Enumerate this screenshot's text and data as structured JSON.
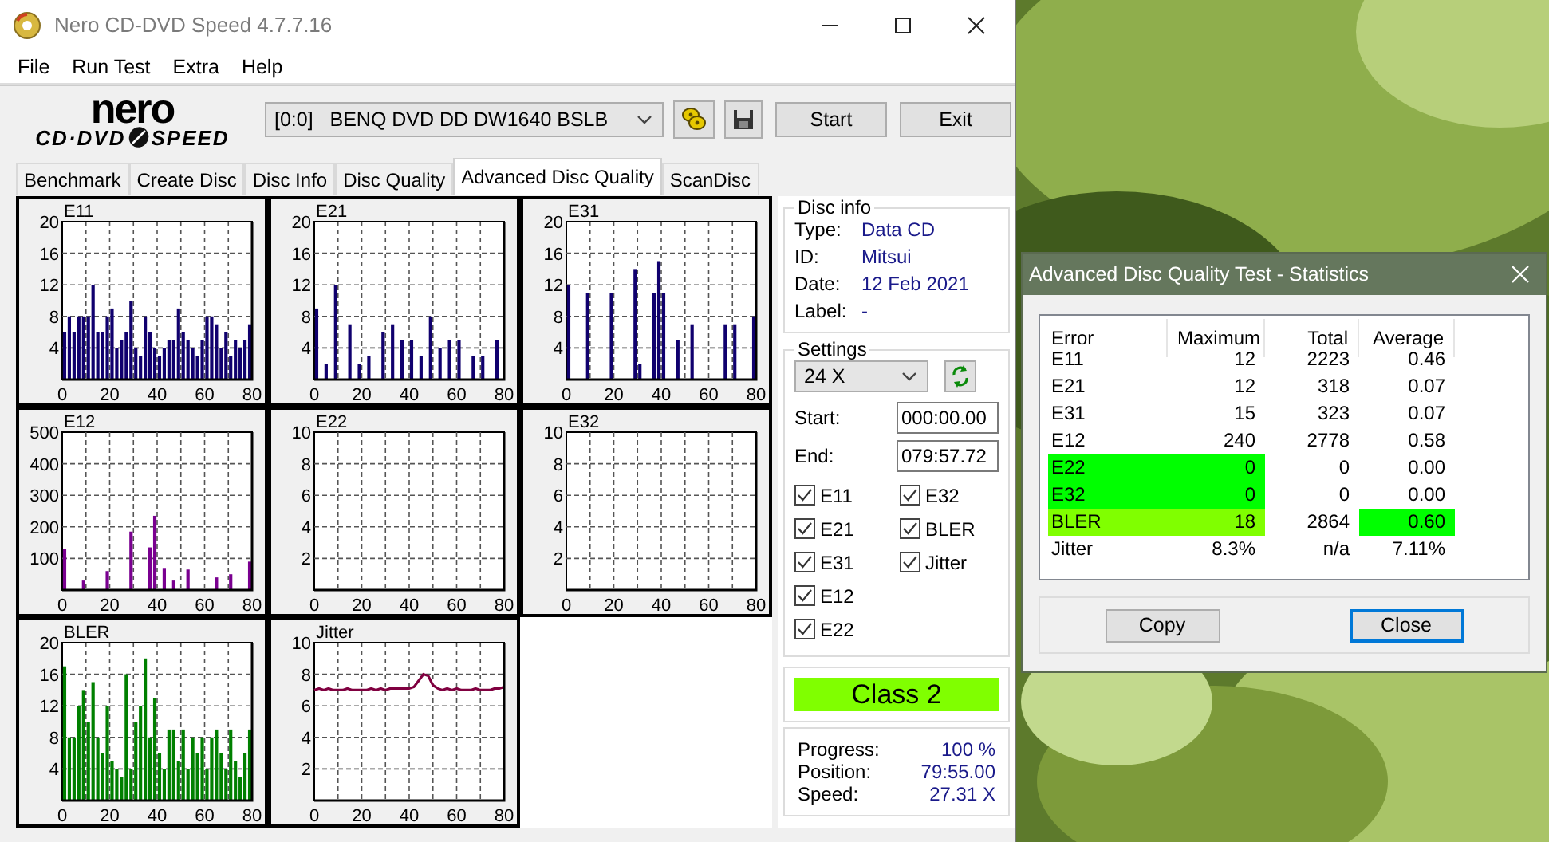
{
  "window": {
    "title": "Nero CD-DVD Speed 4.7.7.16"
  },
  "menu": [
    "File",
    "Run Test",
    "Extra",
    "Help"
  ],
  "logo": {
    "top": "nero",
    "left": "CD·DVD",
    "right": "SPEED"
  },
  "drive": "[0:0]   BENQ DVD DD DW1640 BSLB",
  "buttons": [
    "Start",
    "Exit"
  ],
  "tabs": [
    {
      "label": "Benchmark",
      "selected": false
    },
    {
      "label": "Create Disc",
      "selected": false
    },
    {
      "label": "Disc Info",
      "selected": false
    },
    {
      "label": "Disc Quality",
      "selected": false
    },
    {
      "label": "Advanced Disc Quality",
      "selected": true
    },
    {
      "label": "ScanDisc",
      "selected": false
    }
  ],
  "charts": [
    {
      "chart_data": {
        "type": "bar",
        "title": "E11",
        "grid": true,
        "xlim": [
          0,
          80
        ],
        "ylim": [
          0,
          20
        ],
        "xticks": [
          0,
          20,
          40,
          60,
          80
        ],
        "yticks": [
          4,
          8,
          12,
          16,
          20
        ],
        "x": [
          1,
          3,
          5,
          7,
          9,
          11,
          13,
          15,
          17,
          19,
          21,
          23,
          25,
          27,
          29,
          31,
          33,
          35,
          37,
          39,
          41,
          43,
          45,
          47,
          49,
          51,
          53,
          55,
          57,
          59,
          61,
          63,
          65,
          67,
          69,
          71,
          73,
          75,
          77,
          79
        ],
        "series": [
          {
            "color": "#10006e",
            "values": [
              6,
              8,
              6,
              8,
              8,
              8,
              12,
              6,
              6,
              8,
              9,
              4,
              5,
              6,
              10,
              4,
              3,
              8,
              6,
              4,
              3,
              4,
              5,
              5,
              9,
              6,
              5,
              4,
              3,
              5,
              8,
              8,
              7,
              4,
              6,
              3,
              5,
              4,
              5,
              7
            ]
          }
        ]
      }
    },
    {
      "chart_data": {
        "type": "bar",
        "title": "E21",
        "grid": true,
        "xlim": [
          0,
          80
        ],
        "ylim": [
          0,
          20
        ],
        "xticks": [
          0,
          20,
          40,
          60,
          80
        ],
        "yticks": [
          4,
          8,
          12,
          16,
          20
        ],
        "x": [
          1,
          3,
          5,
          7,
          9,
          11,
          13,
          15,
          17,
          19,
          21,
          23,
          25,
          27,
          29,
          31,
          33,
          35,
          37,
          39,
          41,
          43,
          45,
          47,
          49,
          51,
          53,
          55,
          57,
          59,
          61,
          63,
          65,
          67,
          69,
          71,
          73,
          75,
          77,
          79
        ],
        "series": [
          {
            "color": "#10006e",
            "values": [
              9,
              0,
              2,
              0,
              12,
              0,
              0,
              7,
              0,
              2,
              0,
              3,
              0,
              0,
              6,
              0,
              7,
              0,
              5,
              0,
              5,
              0,
              3,
              0,
              8,
              0,
              4,
              0,
              5,
              0,
              5,
              0,
              0,
              3,
              0,
              3,
              0,
              0,
              5,
              0
            ]
          }
        ]
      }
    },
    {
      "chart_data": {
        "type": "bar",
        "title": "E31",
        "grid": true,
        "xlim": [
          0,
          80
        ],
        "ylim": [
          0,
          20
        ],
        "xticks": [
          0,
          20,
          40,
          60,
          80
        ],
        "yticks": [
          4,
          8,
          12,
          16,
          20
        ],
        "x": [
          1,
          3,
          5,
          7,
          9,
          11,
          13,
          15,
          17,
          19,
          21,
          23,
          25,
          27,
          29,
          31,
          33,
          35,
          37,
          39,
          41,
          43,
          45,
          47,
          49,
          51,
          53,
          55,
          57,
          59,
          61,
          63,
          65,
          67,
          69,
          71,
          73,
          75,
          77,
          79
        ],
        "series": [
          {
            "color": "#10006e",
            "values": [
              12,
              0,
              0,
              0,
              11,
              0,
              0,
              0,
              0,
              11,
              0,
              0,
              0,
              0,
              14,
              2,
              0,
              0,
              11,
              15,
              11,
              0,
              0,
              5,
              0,
              0,
              7,
              0,
              0,
              0,
              0,
              0,
              0,
              7,
              0,
              7,
              0,
              0,
              0,
              8
            ]
          }
        ]
      }
    },
    {
      "chart_data": {
        "type": "bar",
        "title": "E12",
        "grid": true,
        "xlim": [
          0,
          80
        ],
        "ylim": [
          0,
          500
        ],
        "xticks": [
          0,
          20,
          40,
          60,
          80
        ],
        "yticks": [
          100,
          200,
          300,
          400,
          500
        ],
        "x": [
          1,
          3,
          5,
          7,
          9,
          11,
          13,
          15,
          17,
          19,
          21,
          23,
          25,
          27,
          29,
          31,
          33,
          35,
          37,
          39,
          41,
          43,
          45,
          47,
          49,
          51,
          53,
          55,
          57,
          59,
          61,
          63,
          65,
          67,
          69,
          71,
          73,
          75,
          77,
          79
        ],
        "series": [
          {
            "color": "#7a0090",
            "values": [
              130,
              0,
              0,
              0,
              30,
              0,
              0,
              0,
              0,
              60,
              0,
              0,
              0,
              0,
              185,
              0,
              0,
              0,
              135,
              235,
              0,
              70,
              0,
              30,
              0,
              0,
              65,
              0,
              0,
              0,
              0,
              0,
              40,
              0,
              0,
              50,
              0,
              0,
              0,
              90
            ]
          }
        ]
      }
    },
    {
      "chart_data": {
        "type": "bar",
        "title": "E22",
        "grid": true,
        "xlim": [
          0,
          80
        ],
        "ylim": [
          0,
          10
        ],
        "xticks": [
          0,
          20,
          40,
          60,
          80
        ],
        "yticks": [
          2,
          4,
          6,
          8,
          10
        ],
        "x": [
          1,
          3,
          5,
          7,
          9,
          11,
          13,
          15,
          17,
          19,
          21,
          23,
          25,
          27,
          29,
          31,
          33,
          35,
          37,
          39,
          41,
          43,
          45,
          47,
          49,
          51,
          53,
          55,
          57,
          59,
          61,
          63,
          65,
          67,
          69,
          71,
          73,
          75,
          77,
          79
        ],
        "series": [
          {
            "values": [
              0,
              0,
              0,
              0,
              0,
              0,
              0,
              0,
              0,
              0,
              0,
              0,
              0,
              0,
              0,
              0,
              0,
              0,
              0,
              0,
              0,
              0,
              0,
              0,
              0,
              0,
              0,
              0,
              0,
              0,
              0,
              0,
              0,
              0,
              0,
              0,
              0,
              0,
              0,
              0
            ]
          }
        ]
      }
    },
    {
      "chart_data": {
        "type": "bar",
        "title": "E32",
        "grid": true,
        "xlim": [
          0,
          80
        ],
        "ylim": [
          0,
          10
        ],
        "xticks": [
          0,
          20,
          40,
          60,
          80
        ],
        "yticks": [
          2,
          4,
          6,
          8,
          10
        ],
        "x": [
          1,
          3,
          5,
          7,
          9,
          11,
          13,
          15,
          17,
          19,
          21,
          23,
          25,
          27,
          29,
          31,
          33,
          35,
          37,
          39,
          41,
          43,
          45,
          47,
          49,
          51,
          53,
          55,
          57,
          59,
          61,
          63,
          65,
          67,
          69,
          71,
          73,
          75,
          77,
          79
        ],
        "series": [
          {
            "values": [
              0,
              0,
              0,
              0,
              0,
              0,
              0,
              0,
              0,
              0,
              0,
              0,
              0,
              0,
              0,
              0,
              0,
              0,
              0,
              0,
              0,
              0,
              0,
              0,
              0,
              0,
              0,
              0,
              0,
              0,
              0,
              0,
              0,
              0,
              0,
              0,
              0,
              0,
              0,
              0
            ]
          }
        ]
      }
    },
    {
      "chart_data": {
        "type": "bar",
        "title": "BLER",
        "grid": true,
        "xlim": [
          0,
          80
        ],
        "ylim": [
          0,
          20
        ],
        "xticks": [
          0,
          20,
          40,
          60,
          80
        ],
        "yticks": [
          4,
          8,
          12,
          16,
          20
        ],
        "x": [
          1,
          3,
          5,
          7,
          9,
          11,
          13,
          15,
          17,
          19,
          21,
          23,
          25,
          27,
          29,
          31,
          33,
          35,
          37,
          39,
          41,
          43,
          45,
          47,
          49,
          51,
          53,
          55,
          57,
          59,
          61,
          63,
          65,
          67,
          69,
          71,
          73,
          75,
          77,
          79
        ],
        "series": [
          {
            "color": "#008000",
            "values": [
              17,
              8,
              8,
              12,
              14,
              10,
              15,
              8,
              6,
              12,
              5,
              4,
              3,
              16,
              4,
              10,
              12,
              18,
              8,
              13,
              6,
              4,
              9,
              9,
              5,
              9,
              4,
              8,
              6,
              8,
              4,
              8,
              9,
              6,
              4,
              9,
              5,
              3,
              6,
              9
            ]
          }
        ]
      }
    },
    {
      "chart_data": {
        "type": "line",
        "title": "Jitter",
        "grid": true,
        "xlim": [
          0,
          80
        ],
        "ylim": [
          0,
          10
        ],
        "xticks": [
          0,
          20,
          40,
          60,
          80
        ],
        "yticks": [
          2,
          4,
          6,
          8,
          10
        ],
        "x": [
          0,
          2,
          4,
          6,
          8,
          10,
          12,
          14,
          16,
          18,
          20,
          22,
          24,
          26,
          28,
          30,
          32,
          34,
          36,
          38,
          40,
          42,
          44,
          46,
          48,
          50,
          52,
          54,
          56,
          58,
          60,
          62,
          64,
          66,
          68,
          70,
          72,
          74,
          76,
          78,
          80
        ],
        "series": [
          {
            "color": "#800040",
            "values": [
              7.0,
              7.1,
              7.0,
              7.1,
              7.0,
              7.0,
              7.0,
              7.1,
              7.0,
              7.0,
              7.0,
              7.0,
              7.1,
              7.0,
              7.1,
              7.0,
              7.1,
              7.1,
              7.1,
              7.1,
              7.1,
              7.2,
              7.6,
              8.0,
              7.9,
              7.3,
              7.1,
              7.0,
              7.1,
              7.0,
              7.1,
              7.0,
              7.0,
              7.0,
              7.1,
              7.0,
              7.0,
              7.0,
              7.1,
              7.1,
              7.2
            ]
          }
        ]
      }
    }
  ],
  "disc_info": {
    "title": "Disc info",
    "fields": [
      {
        "label": "Type:",
        "value": "Data CD"
      },
      {
        "label": "ID:",
        "value": "Mitsui"
      },
      {
        "label": "Date:",
        "value": "12 Feb 2021"
      },
      {
        "label": "Label:",
        "value": "-"
      }
    ]
  },
  "settings": {
    "title": "Settings",
    "speed": "24 X",
    "start": {
      "label": "Start:",
      "value": "000:00.00"
    },
    "end": {
      "label": "End:",
      "value": "079:57.72"
    },
    "checks": [
      {
        "label": "E11",
        "checked": true
      },
      {
        "label": "E21",
        "checked": true
      },
      {
        "label": "E31",
        "checked": true
      },
      {
        "label": "E12",
        "checked": true
      },
      {
        "label": "E22",
        "checked": true
      },
      {
        "label": "E32",
        "checked": true
      },
      {
        "label": "BLER",
        "checked": true
      },
      {
        "label": "Jitter",
        "checked": true
      }
    ]
  },
  "class_badge": {
    "text": "Class 2",
    "color": "#80ff00"
  },
  "progress": [
    {
      "label": "Progress:",
      "value": "100 %"
    },
    {
      "label": "Position:",
      "value": "79:55.00"
    },
    {
      "label": "Speed:",
      "value": "27.31 X"
    }
  ],
  "stats": {
    "title": "Advanced Disc Quality Test - Statistics",
    "columns": [
      "Error",
      "Maximum",
      "Total",
      "Average"
    ],
    "rows": [
      {
        "cells": [
          {
            "text": "E11"
          },
          {
            "text": "12"
          },
          {
            "text": "2223"
          },
          {
            "text": "0.46"
          }
        ]
      },
      {
        "cells": [
          {
            "text": "E21"
          },
          {
            "text": "12"
          },
          {
            "text": "318"
          },
          {
            "text": "0.07"
          }
        ]
      },
      {
        "cells": [
          {
            "text": "E31"
          },
          {
            "text": "15"
          },
          {
            "text": "323"
          },
          {
            "text": "0.07"
          }
        ]
      },
      {
        "cells": [
          {
            "text": "E12"
          },
          {
            "text": "240"
          },
          {
            "text": "2778"
          },
          {
            "text": "0.58"
          }
        ]
      },
      {
        "cells": [
          {
            "text": "E22",
            "color": "#00ff00"
          },
          {
            "text": "0",
            "color": "#00ff00"
          },
          {
            "text": "0"
          },
          {
            "text": "0.00"
          }
        ]
      },
      {
        "cells": [
          {
            "text": "E32",
            "color": "#00ff00"
          },
          {
            "text": "0",
            "color": "#00ff00"
          },
          {
            "text": "0"
          },
          {
            "text": "0.00"
          }
        ]
      },
      {
        "cells": [
          {
            "text": "BLER",
            "color": "#80ff00"
          },
          {
            "text": "18",
            "color": "#80ff00"
          },
          {
            "text": "2864"
          },
          {
            "text": "0.60",
            "color": "#00ff00"
          }
        ]
      },
      {
        "cells": [
          {
            "text": "Jitter"
          },
          {
            "text": "8.3%"
          },
          {
            "text": "n/a"
          },
          {
            "text": "7.11%"
          }
        ]
      }
    ],
    "buttons": [
      {
        "label": "Copy",
        "default": false
      },
      {
        "label": "Close",
        "default": true
      }
    ]
  }
}
